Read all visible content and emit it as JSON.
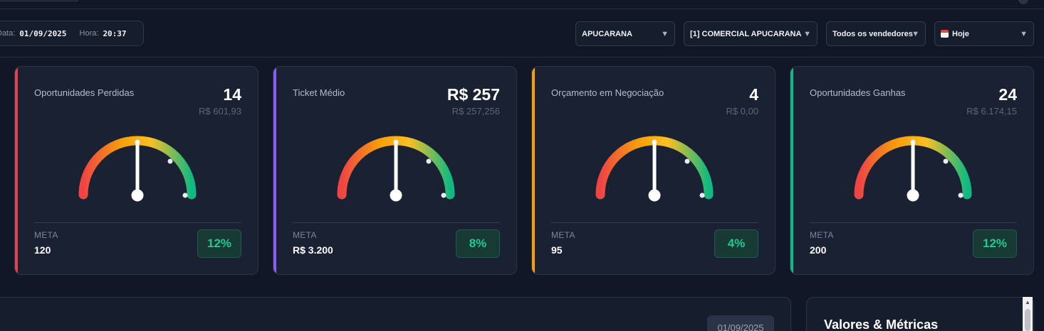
{
  "header": {
    "date_label": "Data:",
    "date_value": "01/09/2025",
    "time_label": "Hora:",
    "time_value": "20:37"
  },
  "filters": {
    "city": "APUCARANA",
    "store": "[1] COMERCIAL APUCARANA",
    "seller": "Todos os vendedores",
    "period": "Hoje"
  },
  "cards": [
    {
      "title": "Oportunidades Perdidas",
      "value": "14",
      "subvalue": "R$ 601,93",
      "meta_label": "META",
      "meta_value": "120",
      "percent": "12%",
      "accent": "#e8404a"
    },
    {
      "title": "Ticket Médio",
      "value": "R$ 257",
      "subvalue": "R$ 257,256",
      "meta_label": "META",
      "meta_value": "R$ 3.200",
      "percent": "8%",
      "accent": "#8b5cf6"
    },
    {
      "title": "Orçamento em Negociação",
      "value": "4",
      "subvalue": "R$ 0,00",
      "meta_label": "META",
      "meta_value": "95",
      "percent": "4%",
      "accent": "#f59e0b"
    },
    {
      "title": "Oportunidades Ganhas",
      "value": "24",
      "subvalue": "R$ 6.174,15",
      "meta_label": "META",
      "meta_value": "200",
      "percent": "12%",
      "accent": "#10b981"
    }
  ],
  "bottom": {
    "date_chip": "01/09/2025",
    "metrics_title": "Valores & Métricas"
  },
  "colors": {
    "gauge_low": "#ef4444",
    "gauge_mid": "#f59e0b",
    "gauge_upper": "#fbbf24",
    "gauge_high": "#10b981",
    "success": "#25c78f"
  }
}
